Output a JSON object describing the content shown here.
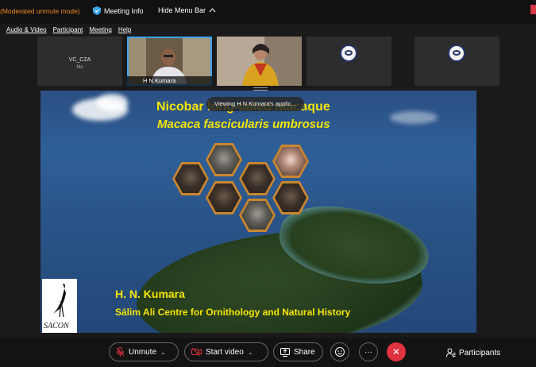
{
  "topbar": {
    "mode": "(Moderated unmute mode)",
    "meeting_info": "Meeting Info",
    "hide_menu": "Hide Menu Bar"
  },
  "menu": [
    "Audio & Video",
    "Participant",
    "Meeting",
    "Help"
  ],
  "thumbnails": [
    {
      "name": "VC_CZA",
      "sub": "Me"
    },
    {
      "name": "H N Kumara"
    },
    {
      "name": ""
    },
    {
      "name": ""
    },
    {
      "name": ""
    }
  ],
  "share": {
    "toast": "Viewing H N Kumara's applic...",
    "title1": "Nicobar long-tailed macaque",
    "title2": "Macaca fascicularis umbrosus",
    "author": "H. N. Kumara",
    "affiliation": "Sálim Ali Centre for Ornithology and Natural History",
    "logo_text": "SACON"
  },
  "controls": {
    "unmute": "Unmute",
    "start_video": "Start video",
    "share": "Share",
    "participants": "Participants"
  },
  "icons": {
    "meeting_info": "shield-icon",
    "chevron_up": "chevron-up-icon",
    "mic_off": "mic-off-icon",
    "video_off": "video-off-icon",
    "share": "share-screen-icon",
    "reactions": "emoji-icon",
    "more": "more-icon",
    "end": "close-icon",
    "participants": "participants-icon"
  },
  "colors": {
    "mode_text": "#f08a24",
    "accent": "#3aa5f0",
    "end_button": "#e0313f",
    "slide_text": "#f5e600"
  }
}
